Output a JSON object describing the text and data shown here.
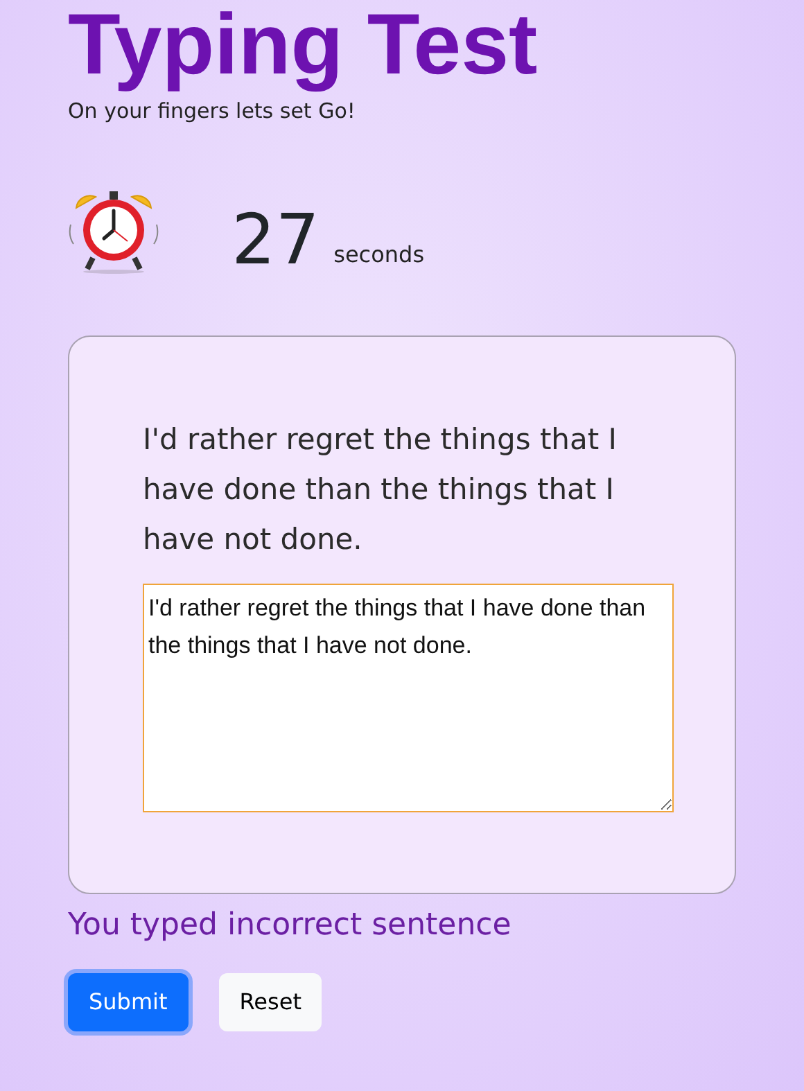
{
  "title": "Typing Test",
  "subtitle": "On your fingers lets set Go!",
  "timer": {
    "value": "27",
    "unit": "seconds"
  },
  "quote": "I'd rather regret the things that I have done than the things that I have not done.",
  "answer": {
    "value": "I'd rather regret the things that I have done than the things that I have not done."
  },
  "message": "You typed incorrect sentence",
  "buttons": [
    {
      "label": "Submit",
      "kind": "primary",
      "focused": true
    },
    {
      "label": "Reset",
      "kind": "light",
      "focused": false
    }
  ]
}
